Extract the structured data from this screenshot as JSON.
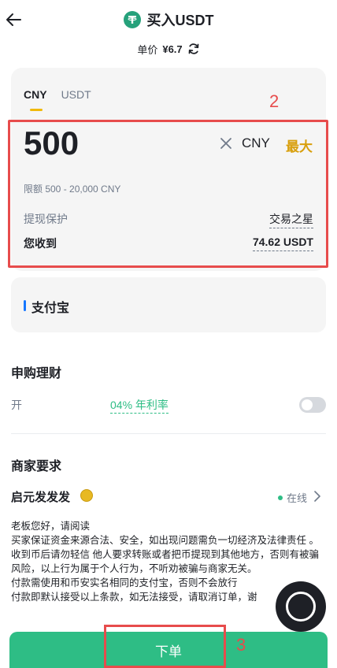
{
  "header": {
    "title": "买入USDT",
    "price_label": "单价",
    "price_value": "¥6.7"
  },
  "order_card": {
    "tabs": [
      {
        "label": "CNY",
        "active": true
      },
      {
        "label": "USDT",
        "active": false
      }
    ],
    "amount": "500",
    "currency": "CNY",
    "max_label": "最大",
    "limit_text": "限额 500 - 20,000 CNY",
    "protection_label": "提现保护",
    "protection_value": "交易之星",
    "receive_label": "您收到",
    "receive_value": "74.62 USDT"
  },
  "payment": {
    "method": "支付宝",
    "accent_color": "#1677ff"
  },
  "earn": {
    "title": "申购理财",
    "prefix": "开",
    "rate_text": "04% 年利率",
    "toggle_on": false
  },
  "merchant": {
    "section_title": "商家要求",
    "name": "启元发发发",
    "status": "在线",
    "terms": [
      "老板您好，请阅读",
      "买家保证资金来源合法、安全，如出现问题需负一切经济及法律责任 。",
      "收到币后请勿轻信 他人要求转账或者把币提现到其他地方，否则有被骗风险，以上行为属于个人行为，不听劝被骗与商家无关。",
      "付款需使用和币安实名相同的支付宝，否则不会放行",
      "付款即默认接受以上条款，如无法接受，请取消订单，谢"
    ]
  },
  "footer": {
    "order_button": "下单",
    "brand_color": "#2ebd85"
  },
  "annotations": {
    "box_label_2": "2",
    "box_label_3": "3"
  }
}
